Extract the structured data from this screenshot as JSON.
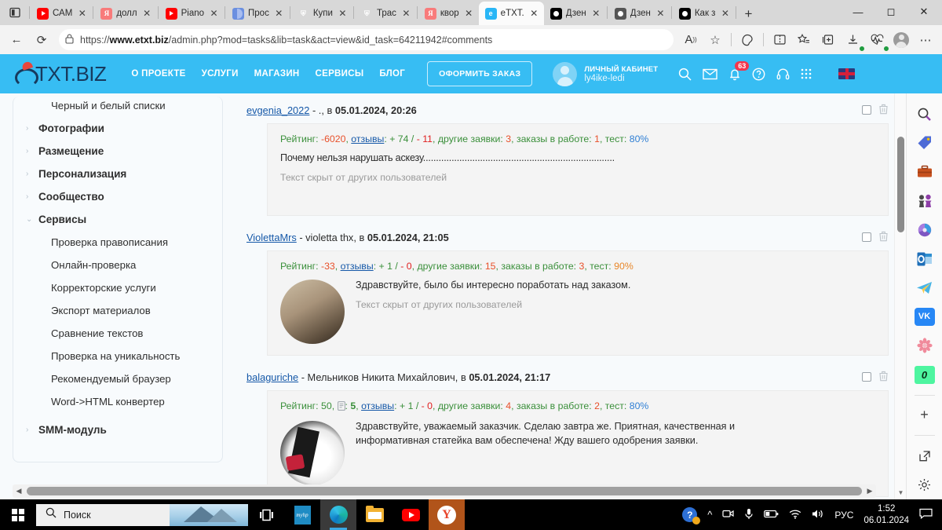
{
  "browser": {
    "tabs": [
      {
        "title": "САМ",
        "icon": "youtube-icon",
        "kind": "yt"
      },
      {
        "title": "долл",
        "icon": "yandex-icon",
        "kind": "ya"
      },
      {
        "title": "Piano",
        "icon": "youtube-icon",
        "kind": "yt"
      },
      {
        "title": "Прос",
        "icon": "blue-doc-icon",
        "kind": "blue"
      },
      {
        "title": "Купи",
        "icon": "shield-icon",
        "kind": "shield"
      },
      {
        "title": "Трас",
        "icon": "shield-icon",
        "kind": "shield"
      },
      {
        "title": "квор",
        "icon": "yandex-icon",
        "kind": "ya"
      },
      {
        "title": "eTXT.",
        "icon": "etxt-icon",
        "kind": "etxt",
        "active": true
      },
      {
        "title": "Дзен",
        "icon": "dzen-icon",
        "kind": "dzen"
      },
      {
        "title": "Дзен",
        "icon": "dzen-icon",
        "kind": "dzengrey"
      },
      {
        "title": "Как з",
        "icon": "dzen-icon",
        "kind": "dzen"
      }
    ],
    "new_tab_label": "+",
    "window_controls": {
      "minimize": "—",
      "maximize": "◻",
      "close": "✕"
    },
    "url_prefix": "https://",
    "url_domain": "www.etxt.biz",
    "url_rest": "/admin.php?mod=tasks&lib=task&act=view&id_task=64211942#comments",
    "back_icon": "←",
    "reload_icon": "⟳",
    "lock_icon": "🔒"
  },
  "site_header": {
    "logo_text": "TXT.BIZ",
    "nav": [
      "О ПРОЕКТЕ",
      "УСЛУГИ",
      "МАГАЗИН",
      "СЕРВИСЫ",
      "БЛОГ"
    ],
    "order_button": "ОФОРМИТЬ ЗАКАЗ",
    "account_label": "ЛИЧНЫЙ КАБИНЕТ",
    "account_user": "ly4ike-ledi",
    "notifications_count": "63",
    "icons": [
      "search-icon",
      "mail-icon",
      "bell-icon",
      "help-icon",
      "headset-icon",
      "grid-icon",
      "flag-uk-icon"
    ]
  },
  "sidebar": {
    "items": [
      {
        "label": "Черный и белый списки",
        "type": "sub",
        "chevron": ""
      },
      {
        "label": "Фотографии",
        "type": "group",
        "chevron": "›"
      },
      {
        "label": "Размещение",
        "type": "group",
        "chevron": "›"
      },
      {
        "label": "Персонализация",
        "type": "group",
        "chevron": "›"
      },
      {
        "label": "Сообщество",
        "type": "group",
        "chevron": "›"
      },
      {
        "label": "Сервисы",
        "type": "group",
        "chevron": "⌄"
      },
      {
        "label": "Проверка правописания",
        "type": "sub",
        "chevron": ""
      },
      {
        "label": "Онлайн-проверка",
        "type": "sub",
        "chevron": ""
      },
      {
        "label": "Корректорские услуги",
        "type": "sub",
        "chevron": ""
      },
      {
        "label": "Экспорт материалов",
        "type": "sub",
        "chevron": ""
      },
      {
        "label": "Сравнение текстов",
        "type": "sub",
        "chevron": ""
      },
      {
        "label": "Проверка на уникальность",
        "type": "sub",
        "chevron": ""
      },
      {
        "label": "Рекомендуемый браузер",
        "type": "sub",
        "chevron": ""
      },
      {
        "label": "Word->HTML конвертер",
        "type": "sub",
        "chevron": ""
      },
      {
        "label": "SMM-модуль",
        "type": "group",
        "chevron": "›"
      }
    ]
  },
  "comments": [
    {
      "username": "evgenia_2022",
      "realname": "- .,",
      "at_label": "в",
      "datetime": "05.01.2024, 20:26",
      "rating_label": "Рейтинг:",
      "rating_value": "-6020",
      "reviews_label": "отзывы",
      "reviews_plus": "+ 74",
      "reviews_minus": "- 11",
      "other_label": "другие заявки:",
      "other_value": "3",
      "inwork_label": "заказы в работе:",
      "inwork_value": "1",
      "test_label": "тест:",
      "test_value": "80%",
      "test_color": "blue",
      "text": "Почему нельзя нарушать аскезу..........................................................................",
      "hidden_note": "Текст скрыт от других пользователей",
      "has_avatar": false
    },
    {
      "username": "ViolettaMrs",
      "realname": "- violetta thx,",
      "at_label": "в",
      "datetime": "05.01.2024, 21:05",
      "rating_label": "Рейтинг:",
      "rating_value": "-33",
      "reviews_label": "отзывы",
      "reviews_plus": "+ 1",
      "reviews_minus": "- 0",
      "other_label": "другие заявки:",
      "other_value": "15",
      "inwork_label": "заказы в работе:",
      "inwork_value": "3",
      "test_label": "тест:",
      "test_value": "90%",
      "test_color": "orange",
      "text": "Здравствуйте, было бы интересно поработать над заказом.",
      "hidden_note": "Текст скрыт от других пользователей",
      "has_avatar": true
    },
    {
      "username": "balaguriche",
      "realname": "- Мельников Никита Михайлович,",
      "at_label": "в",
      "datetime": "05.01.2024, 21:17",
      "rating_label": "Рейтинг:",
      "rating_value": "50",
      "doc_icon_label": "",
      "doc_value": "5",
      "reviews_label": "отзывы",
      "reviews_plus": "+ 1",
      "reviews_minus": "- 0",
      "other_label": "другие заявки:",
      "other_value": "4",
      "inwork_label": "заказы в работе:",
      "inwork_value": "2",
      "test_label": "тест:",
      "test_value": "80%",
      "test_color": "blue",
      "text": "Здравствуйте, уважаемый заказчик. Сделаю завтра же. Приятная, качественная и",
      "text2": "информативная статейка вам обеспечена! Жду вашего одобрения заявки.",
      "hidden_note": "",
      "has_avatar": true
    }
  ],
  "right_rail": {
    "icons": [
      {
        "name": "search-icon",
        "glyph": "🔍"
      },
      {
        "name": "tag-icon",
        "glyph": "🏷"
      },
      {
        "name": "briefcase-icon",
        "glyph": "💼"
      },
      {
        "name": "chess-icon",
        "glyph": "♟"
      },
      {
        "name": "cloud-icon",
        "glyph": "☁"
      },
      {
        "name": "outlook-icon",
        "glyph": "O"
      },
      {
        "name": "telegram-icon",
        "glyph": "✈"
      },
      {
        "name": "vk-icon",
        "glyph": "VK"
      },
      {
        "name": "flower-icon",
        "glyph": "✿"
      },
      {
        "name": "money-icon",
        "glyph": "0"
      },
      {
        "name": "add-icon",
        "glyph": "+"
      },
      {
        "name": "open-external-icon",
        "glyph": "⧉"
      },
      {
        "name": "settings-icon",
        "glyph": "⚙"
      }
    ]
  },
  "taskbar": {
    "search_placeholder": "Поиск",
    "apps": [
      "task-view-icon",
      "myhp-icon",
      "edge-icon",
      "explorer-icon",
      "youtube-icon",
      "yandex-icon"
    ],
    "tray": {
      "lang": "РУС",
      "time": "1:52",
      "date": "06.01.2024"
    }
  }
}
